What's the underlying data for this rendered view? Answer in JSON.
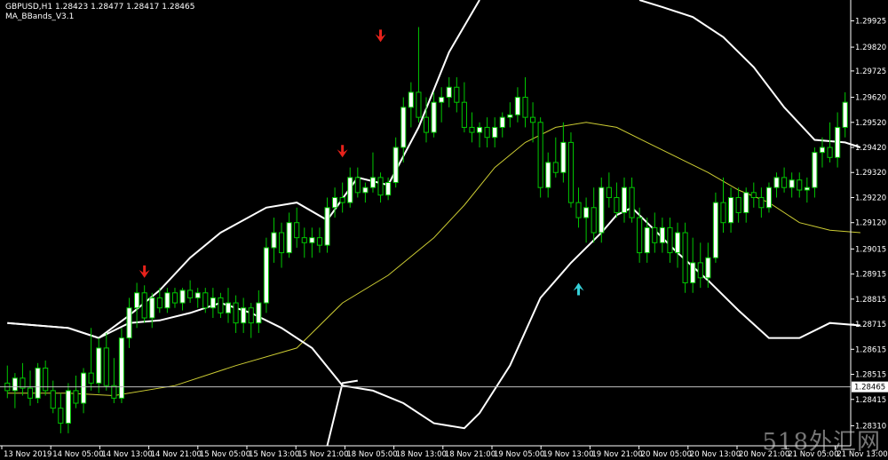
{
  "header": {
    "symbol_line": "GBPUSD,H1  1.28423 1.28477 1.28417 1.28465",
    "indicator": "MA_BBands_V3.1"
  },
  "watermark": "518外汇网",
  "colors": {
    "background": "#000000",
    "bull_candle": "#00c800",
    "bull_body": "#ffffff",
    "bear_candle": "#00c800",
    "bear_body": "#000000",
    "bands": "#ffffff",
    "ma": "#cccc33",
    "sell_arrow": "#e8221b",
    "buy_arrow": "#35d0d8",
    "price_line": "#c0c0c0",
    "axis": "#ffffff"
  },
  "chart_data": {
    "type": "candlestick",
    "ylim": [
      1.2823,
      1.30008
    ],
    "y_ticks": [
      "1.29925",
      "1.29820",
      "1.29725",
      "1.29620",
      "1.29520",
      "1.29420",
      "1.29320",
      "1.29220",
      "1.29120",
      "1.29015",
      "1.28915",
      "1.28815",
      "1.28715",
      "1.28615",
      "1.28515",
      "1.28415",
      "1.28310"
    ],
    "x_labels": [
      "13 Nov 2019",
      "14 Nov 05:00",
      "14 Nov 13:00",
      "14 Nov 21:00",
      "15 Nov 05:00",
      "15 Nov 13:00",
      "15 Nov 21:00",
      "18 Nov 05:00",
      "18 Nov 13:00",
      "18 Nov 21:00",
      "19 Nov 05:00",
      "19 Nov 13:00",
      "19 Nov 21:00",
      "20 Nov 05:00",
      "20 Nov 13:00",
      "20 Nov 21:00",
      "21 Nov 05:00",
      "21 Nov 13:00"
    ],
    "current_price": "1.28465",
    "candles": [
      [
        1.2848,
        1.2855,
        1.2842,
        1.2845
      ],
      [
        1.2845,
        1.2852,
        1.2838,
        1.285
      ],
      [
        1.285,
        1.2856,
        1.2843,
        1.2846
      ],
      [
        1.2846,
        1.2853,
        1.2839,
        1.2842
      ],
      [
        1.2842,
        1.2856,
        1.284,
        1.2854
      ],
      [
        1.2854,
        1.2857,
        1.2843,
        1.2845
      ],
      [
        1.2845,
        1.2849,
        1.2836,
        1.2838
      ],
      [
        1.2838,
        1.2844,
        1.2828,
        1.2832
      ],
      [
        1.2832,
        1.2848,
        1.2828,
        1.2845
      ],
      [
        1.2845,
        1.2851,
        1.2838,
        1.284
      ],
      [
        1.284,
        1.2854,
        1.2836,
        1.2852
      ],
      [
        1.2852,
        1.287,
        1.2845,
        1.2848
      ],
      [
        1.2848,
        1.2866,
        1.2844,
        1.2862
      ],
      [
        1.2862,
        1.2868,
        1.2845,
        1.2847
      ],
      [
        1.2847,
        1.2858,
        1.284,
        1.2842
      ],
      [
        1.2842,
        1.287,
        1.284,
        1.2866
      ],
      [
        1.2866,
        1.2882,
        1.2862,
        1.2878
      ],
      [
        1.2878,
        1.2888,
        1.287,
        1.2884
      ],
      [
        1.2884,
        1.2887,
        1.2872,
        1.2874
      ],
      [
        1.2874,
        1.2884,
        1.287,
        1.2882
      ],
      [
        1.2882,
        1.2886,
        1.2876,
        1.2878
      ],
      [
        1.2878,
        1.2886,
        1.2876,
        1.2884
      ],
      [
        1.2884,
        1.2886,
        1.2878,
        1.288
      ],
      [
        1.288,
        1.2886,
        1.2877,
        1.2885
      ],
      [
        1.2885,
        1.2889,
        1.288,
        1.2882
      ],
      [
        1.2882,
        1.2886,
        1.2878,
        1.2884
      ],
      [
        1.2884,
        1.2886,
        1.2876,
        1.2878
      ],
      [
        1.2878,
        1.2886,
        1.2874,
        1.2882
      ],
      [
        1.2882,
        1.2884,
        1.2874,
        1.2876
      ],
      [
        1.2876,
        1.2886,
        1.2872,
        1.288
      ],
      [
        1.288,
        1.2883,
        1.2868,
        1.2872
      ],
      [
        1.2872,
        1.2882,
        1.2868,
        1.2878
      ],
      [
        1.2878,
        1.288,
        1.2866,
        1.2872
      ],
      [
        1.2872,
        1.2885,
        1.2868,
        1.288
      ],
      [
        1.288,
        1.2906,
        1.2876,
        1.2902
      ],
      [
        1.2902,
        1.2914,
        1.2896,
        1.2908
      ],
      [
        1.2908,
        1.2912,
        1.2894,
        1.29
      ],
      [
        1.29,
        1.2916,
        1.2898,
        1.2912
      ],
      [
        1.2912,
        1.2918,
        1.2902,
        1.2906
      ],
      [
        1.2906,
        1.291,
        1.2898,
        1.2904
      ],
      [
        1.2904,
        1.291,
        1.2898,
        1.2906
      ],
      [
        1.2906,
        1.291,
        1.29,
        1.2903
      ],
      [
        1.2903,
        1.2922,
        1.29,
        1.2918
      ],
      [
        1.2918,
        1.2926,
        1.2914,
        1.2922
      ],
      [
        1.2922,
        1.2928,
        1.2916,
        1.292
      ],
      [
        1.292,
        1.2934,
        1.2918,
        1.293
      ],
      [
        1.293,
        1.2934,
        1.2922,
        1.2924
      ],
      [
        1.2924,
        1.2928,
        1.292,
        1.2926
      ],
      [
        1.2926,
        1.294,
        1.2924,
        1.293
      ],
      [
        1.293,
        1.2932,
        1.292,
        1.2923
      ],
      [
        1.2923,
        1.293,
        1.2921,
        1.2928
      ],
      [
        1.2928,
        1.2946,
        1.2926,
        1.2942
      ],
      [
        1.2942,
        1.2962,
        1.2936,
        1.2958
      ],
      [
        1.2958,
        1.2968,
        1.295,
        1.2964
      ],
      [
        1.2964,
        1.299,
        1.2952,
        1.2954
      ],
      [
        1.2954,
        1.2962,
        1.2944,
        1.2948
      ],
      [
        1.2948,
        1.2964,
        1.2946,
        1.296
      ],
      [
        1.296,
        1.2966,
        1.2952,
        1.2962
      ],
      [
        1.2962,
        1.297,
        1.2958,
        1.2966
      ],
      [
        1.2966,
        1.297,
        1.2956,
        1.296
      ],
      [
        1.296,
        1.2968,
        1.2948,
        1.295
      ],
      [
        1.295,
        1.2956,
        1.2944,
        1.2948
      ],
      [
        1.2948,
        1.2952,
        1.2942,
        1.295
      ],
      [
        1.295,
        1.2954,
        1.2942,
        1.2946
      ],
      [
        1.2946,
        1.2954,
        1.2942,
        1.295
      ],
      [
        1.295,
        1.2956,
        1.2946,
        1.2954
      ],
      [
        1.2954,
        1.296,
        1.295,
        1.2955
      ],
      [
        1.2955,
        1.2966,
        1.2952,
        1.2962
      ],
      [
        1.2962,
        1.297,
        1.295,
        1.2954
      ],
      [
        1.2954,
        1.296,
        1.2944,
        1.2952
      ],
      [
        1.2952,
        1.2954,
        1.2922,
        1.2926
      ],
      [
        1.2926,
        1.294,
        1.2922,
        1.2936
      ],
      [
        1.2936,
        1.2946,
        1.293,
        1.2932
      ],
      [
        1.2932,
        1.2952,
        1.2928,
        1.2944
      ],
      [
        1.2944,
        1.2948,
        1.2918,
        1.292
      ],
      [
        1.292,
        1.2926,
        1.291,
        1.2914
      ],
      [
        1.2914,
        1.2922,
        1.2904,
        1.2918
      ],
      [
        1.2918,
        1.2926,
        1.2904,
        1.2908
      ],
      [
        1.2908,
        1.293,
        1.2904,
        1.2926
      ],
      [
        1.2926,
        1.2932,
        1.2918,
        1.2922
      ],
      [
        1.2922,
        1.2928,
        1.2914,
        1.2916
      ],
      [
        1.2916,
        1.293,
        1.2912,
        1.2926
      ],
      [
        1.2926,
        1.293,
        1.2912,
        1.2914
      ],
      [
        1.2914,
        1.2918,
        1.2896,
        1.29
      ],
      [
        1.29,
        1.2914,
        1.2896,
        1.291
      ],
      [
        1.291,
        1.2916,
        1.29,
        1.2904
      ],
      [
        1.2904,
        1.2914,
        1.29,
        1.291
      ],
      [
        1.291,
        1.2914,
        1.2896,
        1.29
      ],
      [
        1.29,
        1.2912,
        1.2894,
        1.2908
      ],
      [
        1.2908,
        1.2912,
        1.2884,
        1.2888
      ],
      [
        1.2888,
        1.2906,
        1.2884,
        1.2896
      ],
      [
        1.2896,
        1.2904,
        1.2886,
        1.289
      ],
      [
        1.289,
        1.2904,
        1.2886,
        1.2898
      ],
      [
        1.2898,
        1.2924,
        1.2896,
        1.292
      ],
      [
        1.292,
        1.293,
        1.2908,
        1.2912
      ],
      [
        1.2912,
        1.2926,
        1.2908,
        1.2922
      ],
      [
        1.2922,
        1.2926,
        1.2912,
        1.2916
      ],
      [
        1.2916,
        1.2926,
        1.2912,
        1.2924
      ],
      [
        1.2924,
        1.2928,
        1.2918,
        1.2922
      ],
      [
        1.2922,
        1.2926,
        1.2914,
        1.2918
      ],
      [
        1.2918,
        1.2928,
        1.2916,
        1.2926
      ],
      [
        1.2926,
        1.2932,
        1.2922,
        1.293
      ],
      [
        1.293,
        1.2934,
        1.2924,
        1.2926
      ],
      [
        1.2926,
        1.2932,
        1.2922,
        1.2929
      ],
      [
        1.2929,
        1.2932,
        1.2922,
        1.2925
      ],
      [
        1.2925,
        1.293,
        1.292,
        1.2926
      ],
      [
        1.2926,
        1.2942,
        1.2922,
        1.294
      ],
      [
        1.294,
        1.2946,
        1.2934,
        1.2942
      ],
      [
        1.2942,
        1.2952,
        1.2936,
        1.2938
      ],
      [
        1.2938,
        1.2956,
        1.2934,
        1.295
      ],
      [
        1.295,
        1.2964,
        1.2946,
        1.296
      ]
    ],
    "upper_band": [
      [
        0,
        1.2872
      ],
      [
        8,
        1.287
      ],
      [
        12,
        1.2866
      ],
      [
        16,
        1.2875
      ],
      [
        20,
        1.2885
      ],
      [
        24,
        1.2898
      ],
      [
        28,
        1.2908
      ],
      [
        34,
        1.2918
      ],
      [
        38,
        1.292
      ],
      [
        42,
        1.2913
      ],
      [
        46,
        1.293
      ],
      [
        50,
        1.2927
      ],
      [
        54,
        1.295
      ],
      [
        58,
        1.298
      ],
      [
        62,
        1.30008
      ]
    ],
    "upper_band_2": [
      [
        83,
        1.30008
      ],
      [
        86,
        1.2998
      ],
      [
        90,
        1.2994
      ],
      [
        94,
        1.2986
      ],
      [
        98,
        1.2974
      ],
      [
        102,
        1.2958
      ],
      [
        106,
        1.2945
      ],
      [
        110,
        1.2944
      ],
      [
        112,
        1.2942
      ]
    ],
    "lower_band": [
      [
        0,
        1.2872
      ],
      [
        8,
        1.287
      ],
      [
        12,
        1.2866
      ],
      [
        16,
        1.2872
      ],
      [
        20,
        1.2873
      ],
      [
        24,
        1.2876
      ],
      [
        28,
        1.288
      ],
      [
        32,
        1.2876
      ],
      [
        36,
        1.287
      ],
      [
        40,
        1.2862
      ],
      [
        44,
        1.2847
      ],
      [
        48,
        1.2845
      ],
      [
        52,
        1.284
      ],
      [
        56,
        1.2832
      ],
      [
        60,
        1.283
      ],
      [
        62,
        1.2836
      ],
      [
        66,
        1.2855
      ],
      [
        70,
        1.2882
      ],
      [
        74,
        1.2896
      ],
      [
        78,
        1.2908
      ],
      [
        80,
        1.2915
      ],
      [
        82,
        1.2918
      ],
      [
        84,
        1.2912
      ],
      [
        88,
        1.29
      ],
      [
        92,
        1.2889
      ],
      [
        96,
        1.2877
      ],
      [
        100,
        1.2866
      ],
      [
        104,
        1.2866
      ],
      [
        108,
        1.2872
      ],
      [
        112,
        1.2871
      ]
    ],
    "lower_band_pre": [
      [
        42,
        1.2823
      ],
      [
        44,
        1.2848
      ],
      [
        46,
        1.2849
      ]
    ],
    "ma": [
      [
        0,
        1.2844
      ],
      [
        8,
        1.2844
      ],
      [
        14,
        1.2843
      ],
      [
        22,
        1.2847
      ],
      [
        30,
        1.2855
      ],
      [
        38,
        1.2862
      ],
      [
        44,
        1.288
      ],
      [
        50,
        1.2891
      ],
      [
        56,
        1.2906
      ],
      [
        60,
        1.2919
      ],
      [
        64,
        1.2934
      ],
      [
        68,
        1.2944
      ],
      [
        72,
        1.295
      ],
      [
        76,
        1.2952
      ],
      [
        80,
        1.295
      ],
      [
        84,
        1.2944
      ],
      [
        88,
        1.2938
      ],
      [
        92,
        1.2932
      ],
      [
        96,
        1.2925
      ],
      [
        100,
        1.292
      ],
      [
        104,
        1.2912
      ],
      [
        108,
        1.2909
      ],
      [
        112,
        1.2908
      ]
    ],
    "sell_arrows": [
      [
        18,
        1.2884
      ],
      [
        44,
        1.2932
      ],
      [
        49,
        1.2978
      ]
    ],
    "buy_arrows": [
      [
        75,
        1.291
      ]
    ]
  }
}
